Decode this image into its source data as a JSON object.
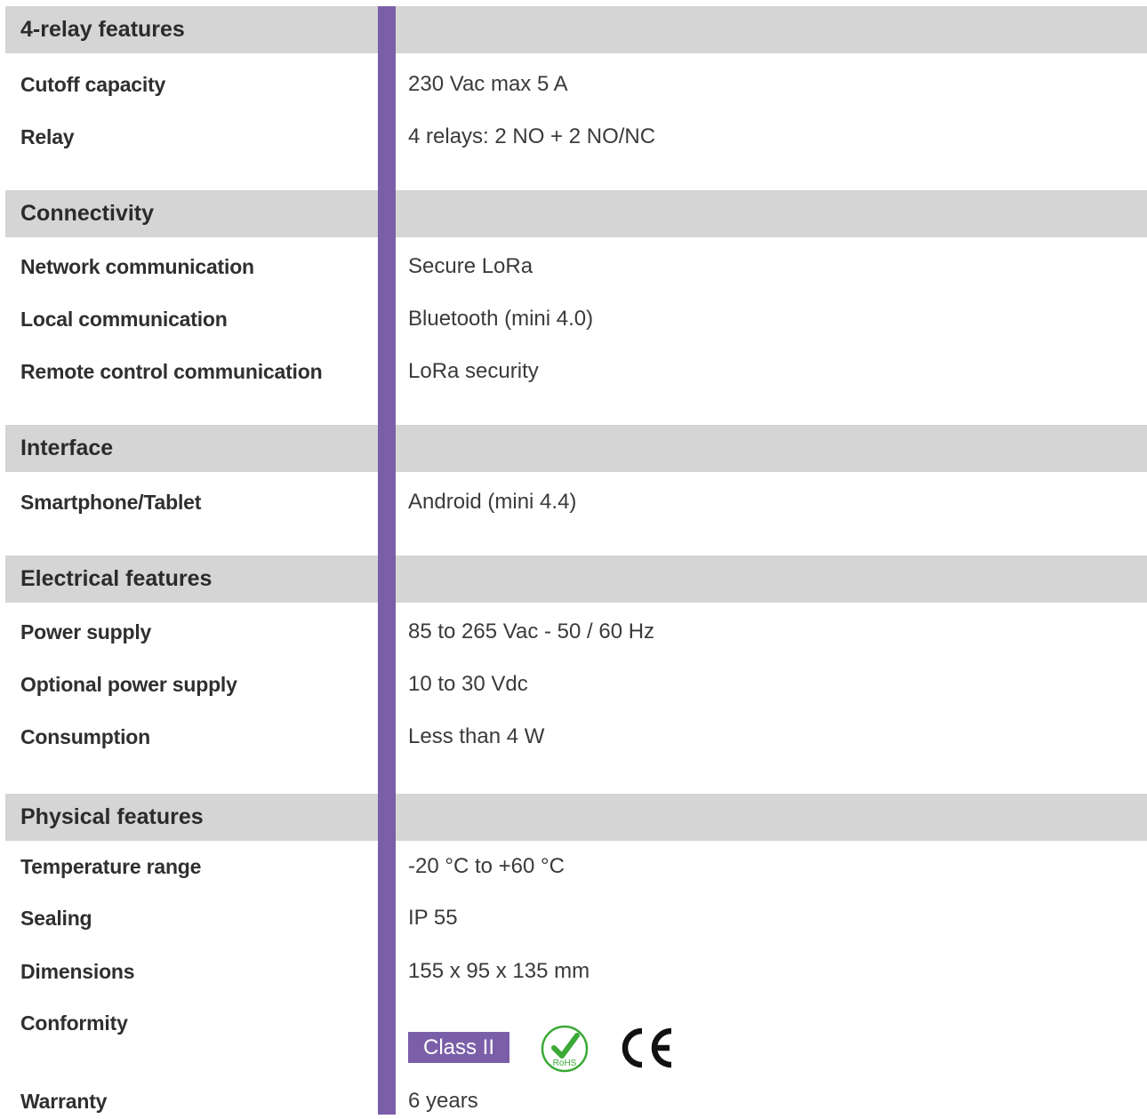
{
  "sections": [
    {
      "title": "4-relay features",
      "rows": [
        {
          "label": "Cutoff capacity",
          "value": "230 Vac max 5 A"
        },
        {
          "label": "Relay",
          "value": "4 relays: 2 NO + 2 NO/NC"
        }
      ]
    },
    {
      "title": "Connectivity",
      "rows": [
        {
          "label": "Network communication",
          "value": "Secure LoRa"
        },
        {
          "label": "Local communication",
          "value": "Bluetooth (mini 4.0)"
        },
        {
          "label": "Remote control communication",
          "value": "LoRa security"
        }
      ]
    },
    {
      "title": "Interface",
      "rows": [
        {
          "label": "Smartphone/Tablet",
          "value": "Android (mini 4.4)"
        }
      ]
    },
    {
      "title": "Electrical features",
      "rows": [
        {
          "label": "Power supply",
          "value": "85 to 265 Vac - 50 / 60 Hz"
        },
        {
          "label": "Optional power supply",
          "value": "10 to 30 Vdc"
        },
        {
          "label": "Consumption",
          "value": "Less than 4 W"
        }
      ]
    },
    {
      "title": "Physical features",
      "rows": [
        {
          "label": "Temperature range",
          "value": "-20 °C to +60 °C"
        },
        {
          "label": "Sealing",
          "value": "IP 55"
        },
        {
          "label": "Dimensions",
          "value": "155 x 95 x 135 mm"
        },
        {
          "label": "Conformity",
          "value": ""
        },
        {
          "label": "Warranty",
          "value": "6 years"
        }
      ]
    }
  ],
  "conformity": {
    "class_label": "Class II",
    "rohs_text": "RoHS",
    "ce_text": "CE",
    "icons": [
      "class-ii-badge",
      "rohs-icon",
      "ce-mark-icon"
    ]
  },
  "colors": {
    "accent": "#7a5fa8",
    "header_bg": "#d5d5d5",
    "rohs_green": "#3aa935"
  }
}
